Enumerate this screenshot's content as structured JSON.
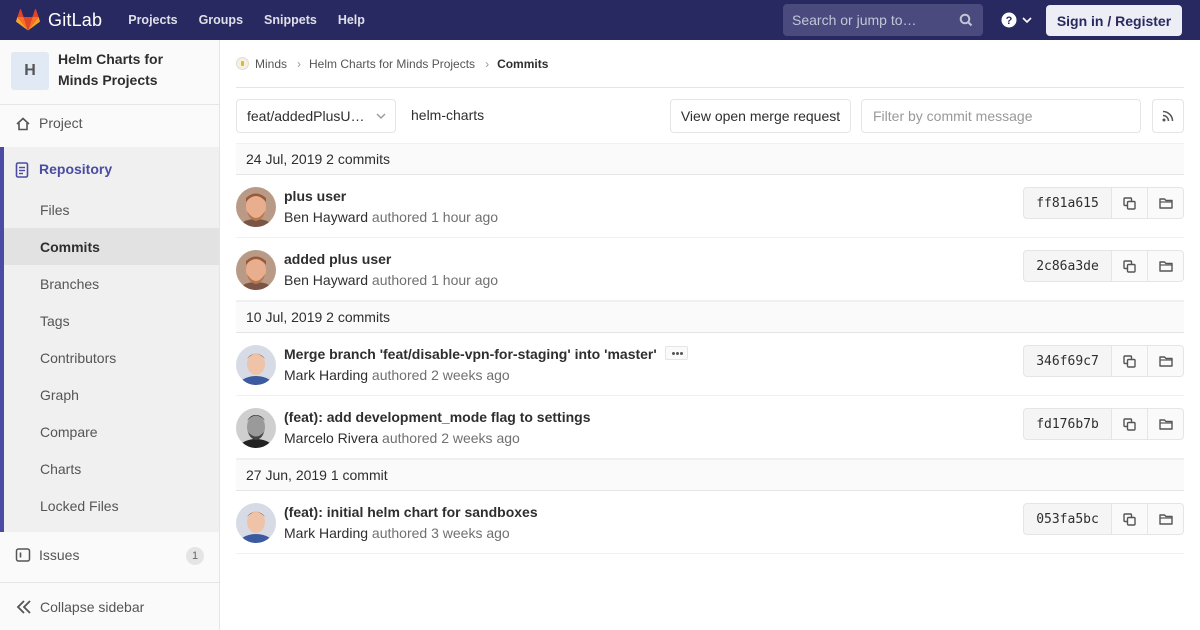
{
  "navbar": {
    "brand": "GitLab",
    "links": [
      "Projects",
      "Groups",
      "Snippets",
      "Help"
    ],
    "search_placeholder": "Search or jump to…",
    "sign_in": "Sign in / Register"
  },
  "sidebar": {
    "project_initial": "H",
    "project_name": "Helm Charts for Minds Projects",
    "project_label": "Project",
    "repository_label": "Repository",
    "repository_items": [
      "Files",
      "Commits",
      "Branches",
      "Tags",
      "Contributors",
      "Graph",
      "Compare",
      "Charts",
      "Locked Files"
    ],
    "active_item": "Commits",
    "issues_label": "Issues",
    "issues_count": "1",
    "collapse_label": "Collapse sidebar"
  },
  "breadcrumb": {
    "items": [
      "Minds",
      "Helm Charts for Minds Projects"
    ],
    "current": "Commits"
  },
  "toolbar": {
    "branch": "feat/addedPlusU…",
    "repo_path": "helm-charts",
    "merge_request_button": "View open merge request",
    "filter_placeholder": "Filter by commit message"
  },
  "days": [
    {
      "date": "24 Jul, 2019 2 commits",
      "commits": [
        {
          "title": "plus user",
          "author": "Ben Hayward",
          "authored": "authored",
          "time": "1 hour ago",
          "sha": "ff81a615",
          "avatar": "ben"
        },
        {
          "title": "added plus user",
          "author": "Ben Hayward",
          "authored": "authored",
          "time": "1 hour ago",
          "sha": "2c86a3de",
          "avatar": "ben"
        }
      ]
    },
    {
      "date": "10 Jul, 2019 2 commits",
      "commits": [
        {
          "title": "Merge branch 'feat/disable-vpn-for-staging' into 'master'",
          "author": "Mark Harding",
          "authored": "authored",
          "time": "2 weeks ago",
          "sha": "346f69c7",
          "avatar": "mark"
        },
        {
          "title": "(feat): add development_mode flag to settings",
          "author": "Marcelo Rivera",
          "authored": "authored",
          "time": "2 weeks ago",
          "sha": "fd176b7b",
          "avatar": "marcelo"
        }
      ]
    },
    {
      "date": "27 Jun, 2019 1 commit",
      "commits": [
        {
          "title": "(feat): initial helm chart for sandboxes",
          "author": "Mark Harding",
          "authored": "authored",
          "time": "3 weeks ago",
          "sha": "053fa5bc",
          "avatar": "mark"
        }
      ]
    }
  ],
  "colors": {
    "navbar": "#292961",
    "accent": "#4b4ba3"
  }
}
